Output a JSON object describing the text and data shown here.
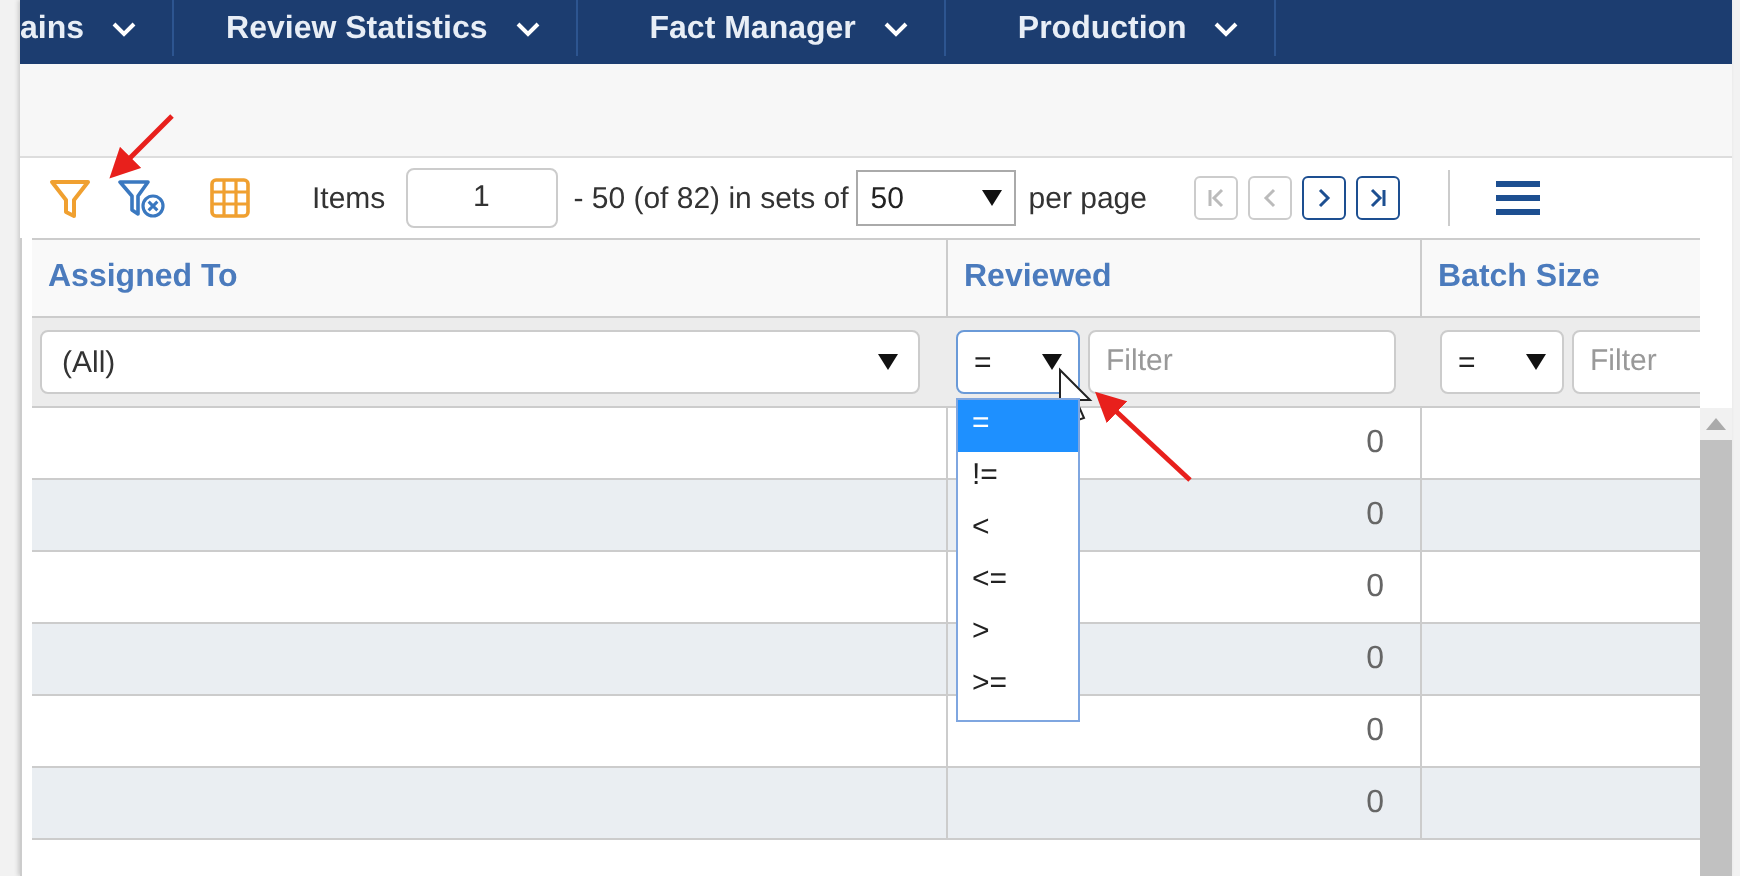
{
  "nav": [
    {
      "label": "ains"
    },
    {
      "label": "Review Statistics"
    },
    {
      "label": "Fact Manager"
    },
    {
      "label": "Production"
    }
  ],
  "toolbar": {
    "items_label": "Items",
    "page_input": "1",
    "range_text": "- 50 (of 82) in sets of",
    "page_size": "50",
    "per_page_label": "per page",
    "pager": [
      {
        "kind": "first",
        "disabled": true
      },
      {
        "kind": "prev",
        "disabled": true
      },
      {
        "kind": "next",
        "disabled": false
      },
      {
        "kind": "last",
        "disabled": false
      }
    ]
  },
  "table": {
    "columns": [
      {
        "label": "Assigned To",
        "filter": {
          "kind": "select",
          "value": "(All)"
        }
      },
      {
        "label": "Reviewed",
        "filter": {
          "kind": "operator",
          "operator": "=",
          "placeholder": "Filter",
          "open": true
        }
      },
      {
        "label": "Batch Size",
        "filter": {
          "kind": "operator",
          "operator": "=",
          "placeholder": "Filter",
          "open": false
        }
      }
    ],
    "rows": [
      {
        "reviewed": "0"
      },
      {
        "reviewed": "0"
      },
      {
        "reviewed": "0"
      },
      {
        "reviewed": "0"
      },
      {
        "reviewed": "0"
      },
      {
        "reviewed": "0"
      }
    ]
  },
  "operator_menu": {
    "options": [
      {
        "label": "=",
        "selected": true
      },
      {
        "label": "!=",
        "selected": false
      },
      {
        "label": "<",
        "selected": false
      },
      {
        "label": "<=",
        "selected": false
      },
      {
        "label": ">",
        "selected": false
      },
      {
        "label": ">=",
        "selected": false
      }
    ]
  }
}
